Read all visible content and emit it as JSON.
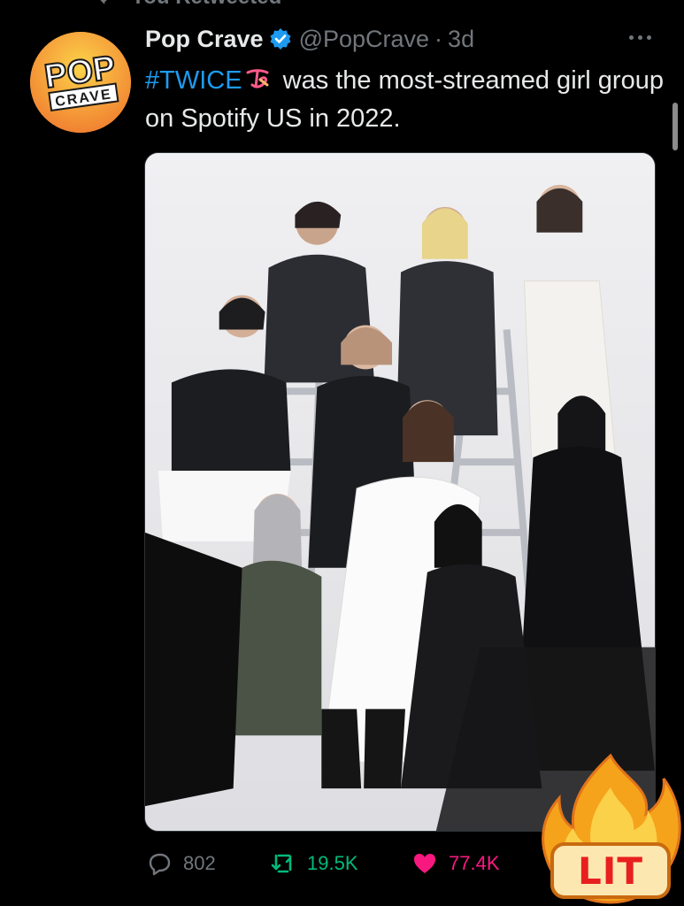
{
  "retweet_header": {
    "label": "You Retweeted",
    "icon": "retweet-icon"
  },
  "tweet": {
    "author_name": "Pop Crave",
    "verified": true,
    "handle": "@PopCrave",
    "separator": "·",
    "time": "3d",
    "avatar_text_top": "POP",
    "avatar_text_bottom": "CRAVE",
    "text_hashtag": "#TWICE",
    "text_rest": " was the most-streamed girl group on Spotify US in 2022.",
    "emoji": "twice-logo-emoji",
    "more_icon": "more-options-icon"
  },
  "media": {
    "description_icon": "group-photo-image"
  },
  "actions": {
    "reply_count": "802",
    "retweet_count": "19.5K",
    "like_count": "77.4K",
    "share_icon": "share-icon"
  },
  "sticker": {
    "label": "LIT",
    "icon": "fire-icon"
  },
  "colors": {
    "background": "#000000",
    "text": "#e7e9ea",
    "muted": "#71767b",
    "link": "#1d9bf0",
    "retweet_green": "#00ba7c",
    "like_pink": "#f91880",
    "avatar_orange": "#f6a43a"
  }
}
